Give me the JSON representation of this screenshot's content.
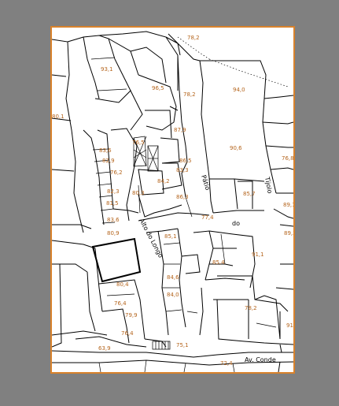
{
  "colors": {
    "viewer_background": "#808080",
    "sheet_border": "#d9822b",
    "elevation_label": "#b5651d",
    "linework": "#000000"
  },
  "map": {
    "streets": [
      {
        "id": "patio-do-tijolo",
        "label": "Pátio"
      },
      {
        "id": "do",
        "label": "do"
      },
      {
        "id": "tijolo",
        "label": "Tijolo"
      },
      {
        "id": "alto-do-longo",
        "label": "Alto do Longo"
      },
      {
        "id": "av-conde",
        "label": "Av. Conde"
      }
    ],
    "elevations": [
      "78,2",
      "93,1",
      "96,5",
      "78,2",
      "94,0",
      "80,1",
      "87,9",
      "90,6",
      "83,6",
      "76,5",
      "82,9",
      "86,5",
      "76,8",
      "76,2",
      "83,3",
      "84,2",
      "82,3",
      "80,3",
      "86,3",
      "85,7",
      "81,5",
      "77,4",
      "89,1",
      "83,6",
      "89,3",
      "80,9",
      "85,1",
      "91,1",
      "80,4",
      "85,4",
      "84,6",
      "76,4",
      "84,0",
      "78,2",
      "79,9",
      "76,4",
      "91",
      "75,1",
      "63,9",
      "72,4"
    ]
  }
}
